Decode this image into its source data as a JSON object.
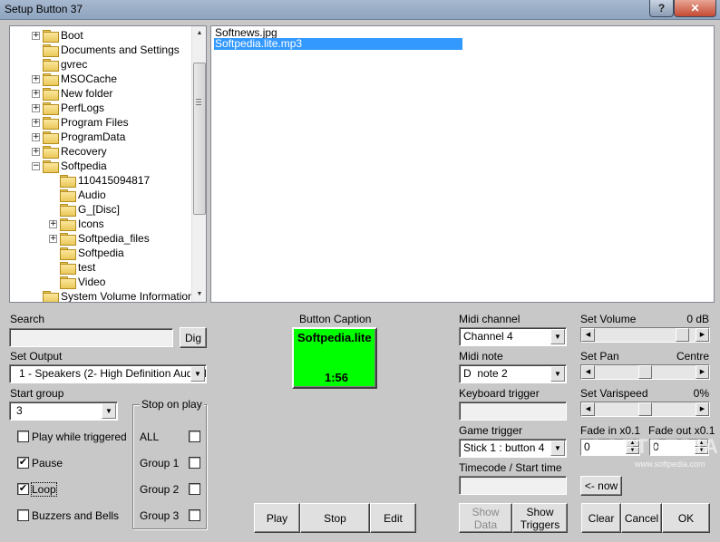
{
  "window": {
    "title": "Setup Button 37",
    "help_glyph": "?",
    "close_glyph": "✕"
  },
  "tree": {
    "items": [
      {
        "label": "Boot",
        "level": 1,
        "expander": "+"
      },
      {
        "label": "Documents and Settings",
        "level": 1,
        "expander": ""
      },
      {
        "label": "gvrec",
        "level": 1,
        "expander": ""
      },
      {
        "label": "MSOCache",
        "level": 1,
        "expander": "+"
      },
      {
        "label": "New folder",
        "level": 1,
        "expander": "+"
      },
      {
        "label": "PerfLogs",
        "level": 1,
        "expander": "+"
      },
      {
        "label": "Program Files",
        "level": 1,
        "expander": "+"
      },
      {
        "label": "ProgramData",
        "level": 1,
        "expander": "+"
      },
      {
        "label": "Recovery",
        "level": 1,
        "expander": "+"
      },
      {
        "label": "Softpedia",
        "level": 1,
        "expander": "−"
      },
      {
        "label": "110415094817",
        "level": 2,
        "expander": ""
      },
      {
        "label": "Audio",
        "level": 2,
        "expander": ""
      },
      {
        "label": "G_[Disc]",
        "level": 2,
        "expander": ""
      },
      {
        "label": "Icons",
        "level": 2,
        "expander": "+"
      },
      {
        "label": "Softpedia_files",
        "level": 2,
        "expander": "+"
      },
      {
        "label": "Softpedia",
        "level": 2,
        "expander": ""
      },
      {
        "label": "test",
        "level": 2,
        "expander": ""
      },
      {
        "label": "Video",
        "level": 2,
        "expander": ""
      },
      {
        "label": "System Volume Information",
        "level": 1,
        "expander": ""
      }
    ]
  },
  "files": {
    "items": [
      {
        "label": "Softnews.jpg",
        "selected": false
      },
      {
        "label": "Softpedia.lite.mp3",
        "selected": true
      }
    ]
  },
  "search": {
    "label": "Search",
    "value": "",
    "dig_label": "Dig"
  },
  "output": {
    "label": "Set Output",
    "value": "1 - Speakers (2- High Definition Audio D"
  },
  "start_group": {
    "label": "Start group",
    "value": "3"
  },
  "options": {
    "play_while_triggered": {
      "label": "Play while triggered",
      "checked": false
    },
    "pause": {
      "label": "Pause",
      "checked": true
    },
    "loop": {
      "label": "Loop",
      "checked": true
    },
    "buzzers": {
      "label": "Buzzers and Bells",
      "checked": false
    }
  },
  "stop_on_play": {
    "title": "Stop on play",
    "items": [
      {
        "label": "ALL",
        "checked": false
      },
      {
        "label": "Group 1",
        "checked": false
      },
      {
        "label": "Group 2",
        "checked": false
      },
      {
        "label": "Group 3",
        "checked": false
      }
    ]
  },
  "caption": {
    "label": "Button Caption",
    "text": "Softpedia.lite",
    "time": "1:56",
    "color": "#00ff00"
  },
  "transport": {
    "play": "Play",
    "stop": "Stop",
    "edit": "Edit"
  },
  "midi": {
    "channel_label": "Midi channel",
    "channel_value": "Channel 4",
    "note_label": "Midi note",
    "note_value": "D  note 2",
    "keyboard_label": "Keyboard trigger",
    "keyboard_value": "",
    "game_label": "Game trigger",
    "game_value": "Stick 1 : button 4",
    "timecode_label": "Timecode / Start time",
    "timecode_value": ""
  },
  "show": {
    "data": "Show Data",
    "triggers": "Show Triggers"
  },
  "volume": {
    "label": "Set Volume",
    "value_text": "0 dB",
    "level": 0.93
  },
  "pan": {
    "label": "Set Pan",
    "value_text": "Centre",
    "level": 0.5
  },
  "varispeed": {
    "label": "Set Varispeed",
    "value_text": "0%",
    "level": 0.5
  },
  "fade": {
    "in_label": "Fade in x0.1",
    "in_value": "0",
    "out_label": "Fade out x0.1",
    "out_value": "0"
  },
  "now_label": "<- now",
  "actions": {
    "clear": "Clear",
    "cancel": "Cancel",
    "ok": "OK"
  },
  "watermark": {
    "text": "SOFTPEDIA",
    "url": "www.softpedia.com"
  }
}
